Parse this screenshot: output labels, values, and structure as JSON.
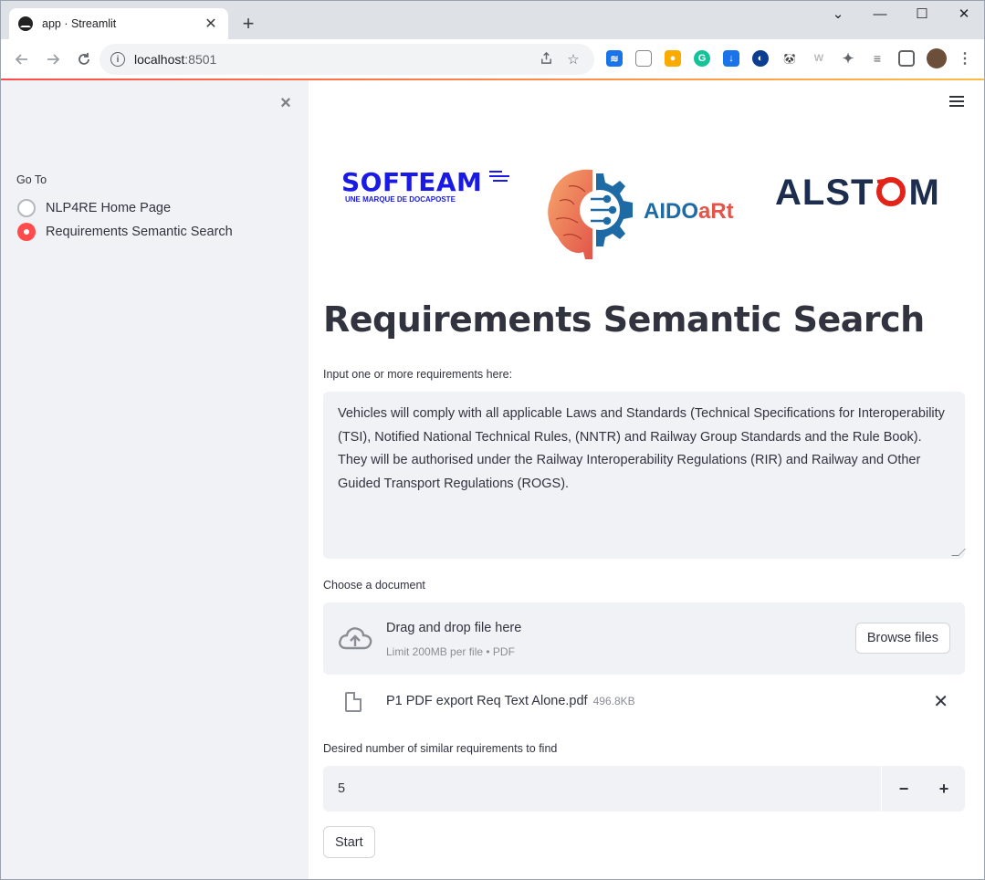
{
  "browser": {
    "tab_title": "app · Streamlit",
    "tab_close": "✕",
    "new_tab": "+",
    "url_host": "localhost",
    "url_port": ":8501",
    "window_controls": {
      "minimize": "—",
      "maximize": "☐",
      "close": "✕",
      "tab_list": "⌄"
    }
  },
  "sidebar": {
    "close": "×",
    "radio_label": "Go To",
    "options": [
      {
        "label": "NLP4RE Home Page",
        "selected": false
      },
      {
        "label": "Requirements Semantic Search",
        "selected": true
      }
    ]
  },
  "logos": {
    "softeam": "SOFTEAM",
    "softeam_tagline": "UNE MARQUE DE DOCAPOSTE",
    "aidoart_a": "AIDO",
    "aidoart_b": "aRt",
    "alstom_pre": "ALST",
    "alstom_post": "M"
  },
  "main": {
    "title": "Requirements Semantic Search",
    "requirements_label": "Input one or more requirements here:",
    "requirements_value": "Vehicles will comply with all applicable Laws and Standards (Technical Specifications for Interoperability (TSI), Notified National Technical Rules, (NNTR) and Railway Group Standards and the Rule Book).  They will be authorised under the Railway Interoperability Regulations (RIR) and Railway and Other Guided Transport Regulations (ROGS).",
    "document_label": "Choose a document",
    "dropzone_title": "Drag and drop file here",
    "dropzone_limit": "Limit 200MB per file • PDF",
    "browse_label": "Browse files",
    "uploaded_file_name": "P1 PDF export Req Text Alone.pdf",
    "uploaded_file_size": "496.8KB",
    "number_label": "Desired number of similar requirements to find",
    "number_value": "5",
    "decrement": "−",
    "increment": "+",
    "start_label": "Start"
  },
  "colors": {
    "accent": "#ff4b4b",
    "sidebar_bg": "#f0f2f6",
    "softeam_blue": "#1a1ae6",
    "alstom_navy": "#1c2d4e",
    "alstom_red": "#e2231a"
  }
}
